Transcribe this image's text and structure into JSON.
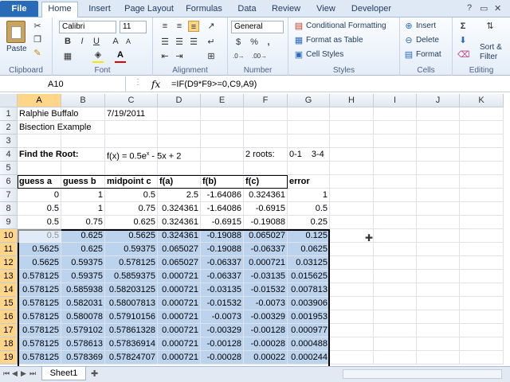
{
  "tabs": [
    "File",
    "Home",
    "Insert",
    "Page Layout",
    "Formulas",
    "Data",
    "Review",
    "View",
    "Developer"
  ],
  "active_tab": "Home",
  "ribbon": {
    "clipboard": {
      "paste": "Paste",
      "label": "Clipboard"
    },
    "font": {
      "name": "Calibri",
      "size": "11",
      "bold": "B",
      "italic": "I",
      "underline": "U",
      "label": "Font"
    },
    "alignment": {
      "label": "Alignment"
    },
    "number": {
      "format": "General",
      "currency": "$",
      "percent": "%",
      "comma": ",",
      "label": "Number"
    },
    "styles": {
      "conditional": "Conditional Formatting",
      "table": "Format as Table",
      "cell": "Cell Styles",
      "label": "Styles"
    },
    "cells": {
      "insert": "Insert",
      "delete": "Delete",
      "format": "Format",
      "label": "Cells"
    },
    "editing": {
      "sum": "Σ",
      "sort": "Sort &",
      "filter": "Filter",
      "label": "Editing"
    }
  },
  "formula_bar": {
    "name_box": "A10",
    "fx": "fx",
    "formula": "=IF(D9*F9>=0,C9,A9)"
  },
  "columns": [
    "A",
    "B",
    "C",
    "D",
    "E",
    "F",
    "G",
    "H",
    "I",
    "J",
    "K"
  ],
  "rows": [
    {
      "n": "1",
      "cells": [
        "Ralphie Buffalo",
        "",
        "7/19/2011",
        "",
        "",
        "",
        ""
      ]
    },
    {
      "n": "2",
      "cells": [
        "Bisection Example",
        "",
        "",
        "",
        "",
        "",
        ""
      ]
    },
    {
      "n": "3",
      "cells": [
        "",
        "",
        "",
        "",
        "",
        "",
        ""
      ]
    },
    {
      "n": "4",
      "cells": [
        "Find the Root:",
        "",
        "f(x) = 0.5e",
        "",
        "",
        "2 roots:",
        "0-1"
      ],
      "extra": {
        "exp": "x",
        "rest": " - 5x + 2",
        "g2": "3-4"
      }
    },
    {
      "n": "5",
      "cells": [
        "",
        "",
        "",
        "",
        "",
        "",
        ""
      ]
    },
    {
      "n": "6",
      "cells": [
        "guess a",
        "guess b",
        "midpoint c",
        "f(a)",
        "f(b)",
        "f(c)",
        "error"
      ]
    },
    {
      "n": "7",
      "cells": [
        "0",
        "1",
        "0.5",
        "2.5",
        "-1.64086",
        "0.324361",
        "1"
      ]
    },
    {
      "n": "8",
      "cells": [
        "0.5",
        "1",
        "0.75",
        "0.324361",
        "-1.64086",
        "-0.6915",
        "0.5"
      ]
    },
    {
      "n": "9",
      "cells": [
        "0.5",
        "0.75",
        "0.625",
        "0.324361",
        "-0.6915",
        "-0.19088",
        "0.25"
      ]
    },
    {
      "n": "10",
      "cells": [
        "0.5",
        "0.625",
        "0.5625",
        "0.324361",
        "-0.19088",
        "0.065027",
        "0.125"
      ]
    },
    {
      "n": "11",
      "cells": [
        "0.5625",
        "0.625",
        "0.59375",
        "0.065027",
        "-0.19088",
        "-0.06337",
        "0.0625"
      ]
    },
    {
      "n": "12",
      "cells": [
        "0.5625",
        "0.59375",
        "0.578125",
        "0.065027",
        "-0.06337",
        "0.000721",
        "0.03125"
      ]
    },
    {
      "n": "13",
      "cells": [
        "0.578125",
        "0.59375",
        "0.5859375",
        "0.000721",
        "-0.06337",
        "-0.03135",
        "0.015625"
      ]
    },
    {
      "n": "14",
      "cells": [
        "0.578125",
        "0.585938",
        "0.58203125",
        "0.000721",
        "-0.03135",
        "-0.01532",
        "0.007813"
      ]
    },
    {
      "n": "15",
      "cells": [
        "0.578125",
        "0.582031",
        "0.58007813",
        "0.000721",
        "-0.01532",
        "-0.0073",
        "0.003906"
      ]
    },
    {
      "n": "16",
      "cells": [
        "0.578125",
        "0.580078",
        "0.57910156",
        "0.000721",
        "-0.0073",
        "-0.00329",
        "0.001953"
      ]
    },
    {
      "n": "17",
      "cells": [
        "0.578125",
        "0.579102",
        "0.57861328",
        "0.000721",
        "-0.00329",
        "-0.00128",
        "0.000977"
      ]
    },
    {
      "n": "18",
      "cells": [
        "0.578125",
        "0.578613",
        "0.57836914",
        "0.000721",
        "-0.00128",
        "-0.00028",
        "0.000488"
      ]
    },
    {
      "n": "19",
      "cells": [
        "0.578125",
        "0.578369",
        "0.57824707",
        "0.000721",
        "-0.00028",
        "0.00022",
        "0.000244"
      ]
    }
  ],
  "sheet_tabs": [
    "Sheet1"
  ]
}
